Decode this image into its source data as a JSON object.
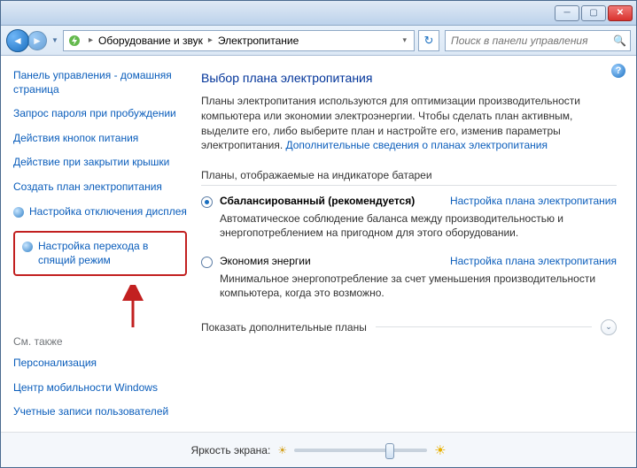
{
  "titlebar": {
    "min": "─",
    "max": "▢",
    "close": "✕"
  },
  "nav": {
    "back": "◄",
    "fwd": "►",
    "drop": "▼"
  },
  "breadcrumb": {
    "sep": "▸",
    "items": [
      "Оборудование и звук",
      "Электропитание"
    ],
    "drop": "▾",
    "refresh": "↻"
  },
  "search": {
    "placeholder": "Поиск в панели управления",
    "icon": "🔍"
  },
  "help": "?",
  "sidebar": {
    "links": [
      "Панель управления - домашняя страница",
      "Запрос пароля при пробуждении",
      "Действия кнопок питания",
      "Действие при закрытии крышки",
      "Создать план электропитания",
      "Настройка отключения дисплея",
      "Настройка перехода в спящий режим"
    ],
    "see_also_heading": "См. также",
    "see_also": [
      "Персонализация",
      "Центр мобильности Windows",
      "Учетные записи пользователей"
    ]
  },
  "content": {
    "heading": "Выбор плана электропитания",
    "desc": "Планы электропитания используются для оптимизации производительности компьютера или экономии электроэнергии. Чтобы сделать план активным, выделите его, либо выберите план и настройте его, изменив параметры электропитания. ",
    "desc_link": "Дополнительные сведения о планах электропитания",
    "section": "Планы, отображаемые на индикаторе батареи",
    "plans": [
      {
        "name": "Сбалансированный",
        "suffix": "(рекомендуется)",
        "link": "Настройка плана электропитания",
        "desc": "Автоматическое соблюдение баланса между производительностью и энергопотреблением на пригодном для этого оборудовании.",
        "checked": true
      },
      {
        "name": "Экономия энергии",
        "suffix": "",
        "link": "Настройка плана электропитания",
        "desc": "Минимальное энергопотребление за счет уменьшения производительности компьютера, когда это возможно.",
        "checked": false
      }
    ],
    "show_more": "Показать дополнительные планы",
    "expand": "⌄"
  },
  "footer": {
    "label": "Яркость экрана:",
    "dim": "☀",
    "full": "☀",
    "thumb_pct": 72
  }
}
